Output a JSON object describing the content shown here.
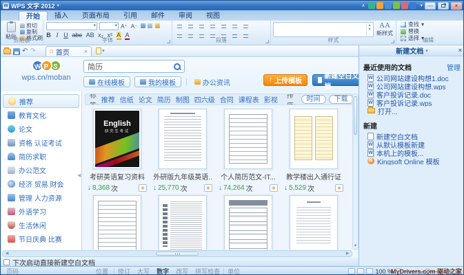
{
  "window": {
    "title": "WPS 文字 2012"
  },
  "colors": {
    "titlebar_blue": "#3474c4",
    "accent_orange": "#f7860b",
    "accent_blue": "#2e77c0",
    "download_green": "#2fa33c",
    "link_blue": "#2f6fc1"
  },
  "icons": {
    "dropdown": "▾",
    "collapse": "∧",
    "close": "×",
    "minimize": "—",
    "undo": "↶",
    "redo": "↷",
    "down_arrow": "↓",
    "up_arrow": "↑",
    "left_arrow": "◀",
    "right_arrow": "▶",
    "down_small": "▼",
    "up_small": "▲",
    "star": "★",
    "grid": "⊞",
    "home": "⌂",
    "minus": "−",
    "plus": "+"
  },
  "menu_tabs": [
    "开始",
    "插入",
    "页面布局",
    "引用",
    "邮件",
    "审阅",
    "视图"
  ],
  "ribbon": {
    "paste_label": "粘贴",
    "clipboard_items": [
      "剪切",
      "复制",
      "格式刷"
    ],
    "groups": {
      "clipboard": "剪贴板",
      "font": "字体",
      "paragraph": "段落",
      "style": "样式",
      "edit": "编辑"
    },
    "font_size_glyphs": [
      "A⁺",
      "A⁻"
    ],
    "font_glyphs": [
      "B",
      "I",
      "U",
      "abc",
      "AB",
      "x₂",
      "x²",
      "A",
      "A"
    ],
    "new_style": "新样式",
    "edit_items": [
      "查找",
      "替换",
      "选择"
    ]
  },
  "doc_tabbar": {
    "home_tab": "首页"
  },
  "home": {
    "logo_letters": [
      "W",
      "P",
      "S"
    ],
    "logo_url": "wps.cn/moban",
    "search_value": "简历",
    "nav_buttons": [
      "在线模板",
      "我的模板",
      "办公资讯"
    ],
    "upload_button": "上传模板",
    "new_blank_button": "新建空白文档",
    "sidebar": [
      "推荐",
      "教育文化",
      "论文",
      "资格 认证考试",
      "简历求职",
      "办公范文",
      "经济 贸易 财会",
      "管理 人力资源",
      "外语学习",
      "生活休闲",
      "节日庆典 比赛"
    ],
    "filter": {
      "label": "标签:",
      "tags": [
        "推荐",
        "信纸",
        "论文",
        "简历",
        "制图",
        "四六级",
        "合同",
        "课程表",
        "影视"
      ],
      "sort_label": "排序:",
      "sort_time": "时间",
      "sort_download": "下载"
    },
    "download_unit": "次",
    "templates": [
      {
        "title": "考研英语复习资料",
        "downloads": "8,368",
        "cover_title": "English",
        "cover_subtitle": "研究生考试"
      },
      {
        "title": "外研版九年级英语..",
        "downloads": "25,770"
      },
      {
        "title": "个人简历范文-IT...",
        "downloads": "74,264"
      },
      {
        "title": "教学楼出入通行证",
        "downloads": "5,529"
      }
    ],
    "startup_checkbox_label": "下次启动直接新建空白文档"
  },
  "task_pane": {
    "title": "新建文档",
    "recent_section": "最近使用的文档",
    "manage_link": "管理",
    "recent_files": [
      "公司网站建设构想1.doc",
      "公司网站建设构想.wps",
      "客户投诉记录.doc",
      "客户投诉记录.wps"
    ],
    "open_item": "打开...",
    "new_section": "新建",
    "new_items": [
      "新建空白文档",
      "从默认模板新建",
      "本机上的模板...",
      "Kingsoft Online 模板"
    ]
  },
  "status_bar": {
    "left_items": [
      "页码",
      "位置",
      "修订",
      "大写",
      "数字",
      "改写",
      "拼写检查",
      "单位"
    ],
    "zoom_value": "100 %",
    "watermark": "MyDrivers.com 驱动之家"
  }
}
